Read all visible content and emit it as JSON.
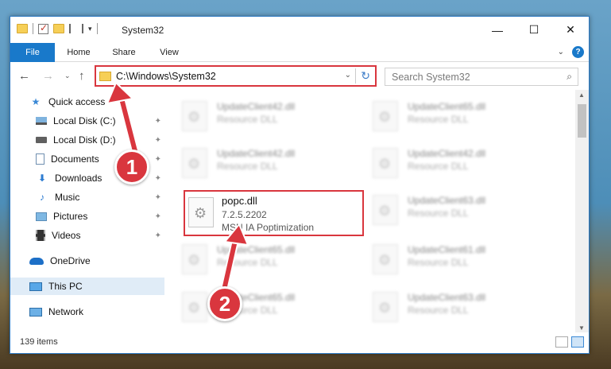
{
  "window": {
    "title": "System32"
  },
  "titlebar": {
    "minimize": "—",
    "maximize": "☐",
    "close": "✕"
  },
  "ribbon": {
    "tabs": [
      "File",
      "Home",
      "Share",
      "View"
    ],
    "expand": "⌄",
    "help": "?"
  },
  "nav": {
    "back": "←",
    "forward": "→",
    "recent": "⌄",
    "up": "↑",
    "address": "C:\\Windows\\System32",
    "dropdown": "⌄",
    "refresh": "↻",
    "search_placeholder": "Search System32"
  },
  "sidebar": {
    "items": [
      {
        "label": "Quick access",
        "icon": "star-icon"
      },
      {
        "label": "Local Disk (C:)",
        "icon": "drive-c-icon",
        "pinned": true
      },
      {
        "label": "Local Disk (D:)",
        "icon": "drive-icon",
        "pinned": true
      },
      {
        "label": "Documents",
        "icon": "documents-icon",
        "pinned": true
      },
      {
        "label": "Downloads",
        "icon": "downloads-icon",
        "pinned": true
      },
      {
        "label": "Music",
        "icon": "music-icon",
        "pinned": true
      },
      {
        "label": "Pictures",
        "icon": "pictures-icon",
        "pinned": true
      },
      {
        "label": "Videos",
        "icon": "videos-icon",
        "pinned": true
      },
      {
        "label": "OneDrive",
        "icon": "onedrive-icon"
      },
      {
        "label": "This PC",
        "icon": "this-pc-icon",
        "selected": true
      },
      {
        "label": "Network",
        "icon": "network-icon"
      }
    ]
  },
  "files": [
    {
      "name": "UpdateClient42.dll",
      "type": "Resource DLL",
      "blurred": true
    },
    {
      "name": "UpdateClient65.dll",
      "type": "Resource DLL",
      "blurred": true
    },
    {
      "name": "UpdateClient42.dll",
      "type": "Resource DLL",
      "blurred": true
    },
    {
      "name": "UpdateClient42.dll",
      "type": "Resource DLL",
      "blurred": true
    },
    {
      "name": "popc.dll",
      "version": "7.2.5.2202",
      "description": "MSN IA Poptimization",
      "highlighted": true
    },
    {
      "name": "UpdateClient63.dll",
      "type": "Resource DLL",
      "blurred": true
    },
    {
      "name": "UpdateClient65.dll",
      "type": "Resource DLL",
      "blurred": true
    },
    {
      "name": "UpdateClient61.dll",
      "type": "Resource DLL",
      "blurred": true
    },
    {
      "name": "UpdateClient65.dll",
      "type": "Resource DLL",
      "blurred": true
    },
    {
      "name": "UpdateClient63.dll",
      "type": "Resource DLL",
      "blurred": true
    }
  ],
  "status": {
    "count": "139 items"
  },
  "annotations": [
    {
      "label": "1"
    },
    {
      "label": "2"
    }
  ],
  "colors": {
    "accent": "#1979ca",
    "highlight": "#d9363e",
    "selected": "#e0ecf7"
  }
}
